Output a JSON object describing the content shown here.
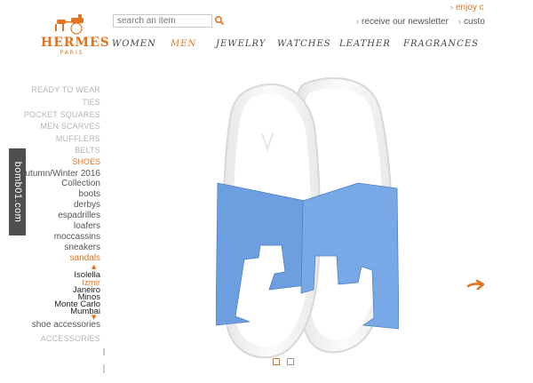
{
  "brand": {
    "name": "HERMES",
    "city": "PARIS"
  },
  "search": {
    "placeholder": "search an item"
  },
  "top_links": {
    "enjoy": "enjoy c",
    "newsletter": "receive our newsletter",
    "customer": "custo"
  },
  "nav": [
    "WOMEN",
    "MEN",
    "JEWELRY",
    "WATCHES",
    "LEATHER",
    "FRAGRANCES"
  ],
  "nav_active": "MEN",
  "sidebar": {
    "categories": [
      "READY TO WEAR",
      "TIES",
      "POCKET SQUARES",
      "MEN SCARVES",
      "MUFFLERS",
      "BELTS"
    ],
    "active_category": "SHOES",
    "season": "Autumn/Winter 2016",
    "subcats": [
      "Collection",
      "boots",
      "derbys",
      "espadrilles",
      "loafers",
      "moccassins",
      "sneakers"
    ],
    "active_subcat": "sandals",
    "models": [
      "Isolella",
      "Izmir",
      "Janeiro",
      "Minos",
      "Monte Carlo",
      "Mumbai"
    ],
    "active_model": "Izmir",
    "shoe_accessories": "shoe accessories",
    "accessories": "ACCESSORIES"
  },
  "watermark": "bomb01.com",
  "colors": {
    "accent": "#e2731f",
    "strap": "#6d9ee0",
    "sole": "#f4f4f4"
  },
  "carousel": {
    "pages": 2,
    "active": 1
  },
  "icons": [
    "search-icon",
    "next-arrow-icon",
    "carriage-logo-icon"
  ]
}
